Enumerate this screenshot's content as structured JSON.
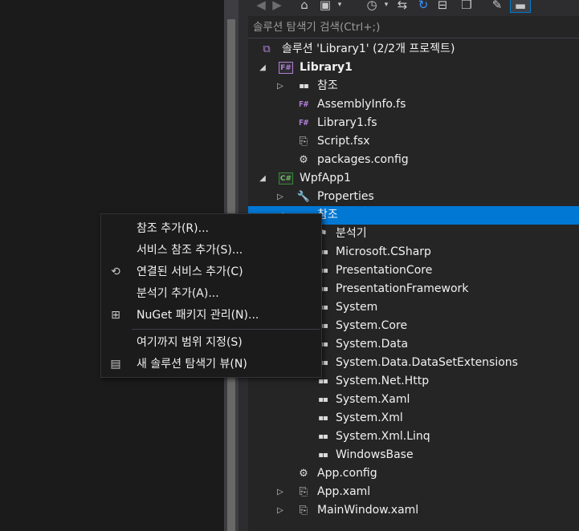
{
  "toolbar": {
    "icons": [
      "back-icon",
      "forward-icon",
      "home-icon",
      "switch-views-icon",
      "pending-changes-icon",
      "sync-icon",
      "refresh-icon",
      "collapse-all-icon",
      "show-all-files-icon",
      "properties-icon",
      "preview-icon"
    ]
  },
  "search": {
    "placeholder": "솔루션 탐색기 검색(Ctrl+;)"
  },
  "tree": {
    "solution": "솔루션 'Library1' (2/2개 프로젝트)",
    "library_project": "Library1",
    "library_references": "참조",
    "library_files": [
      "AssemblyInfo.fs",
      "Library1.fs",
      "Script.fsx",
      "packages.config"
    ],
    "wpf_project": "WpfApp1",
    "wpf_properties": "Properties",
    "wpf_references": "참조",
    "wpf_analyzers": "분석기",
    "wpf_reference_items": [
      "Microsoft.CSharp",
      "PresentationCore",
      "PresentationFramework",
      "System",
      "System.Core",
      "System.Data",
      "System.Data.DataSetExtensions",
      "System.Net.Http",
      "System.Xaml",
      "System.Xml",
      "System.Xml.Linq",
      "WindowsBase"
    ],
    "wpf_files": [
      "App.config",
      "App.xaml",
      "MainWindow.xaml"
    ]
  },
  "context_menu": {
    "items": [
      {
        "label": "참조 추가(R)...",
        "icon": ""
      },
      {
        "label": "서비스 참조 추가(S)...",
        "icon": ""
      },
      {
        "label": "연결된 서비스 추가(C)",
        "icon": "connected-service-icon"
      },
      {
        "label": "분석기 추가(A)...",
        "icon": ""
      },
      {
        "label": "NuGet 패키지 관리(N)...",
        "icon": "nuget-package-icon"
      },
      {
        "label": "여기까지 범위 지정(S)",
        "icon": ""
      },
      {
        "label": "새 솔루션 탐색기 뷰(N)",
        "icon": "new-explorer-view-icon"
      }
    ]
  },
  "colors": {
    "selection": "#0078d4",
    "fsharp": "#b180d7",
    "csharp": "#388a34",
    "panel": "#252526",
    "menu": "#1b1b1c"
  }
}
